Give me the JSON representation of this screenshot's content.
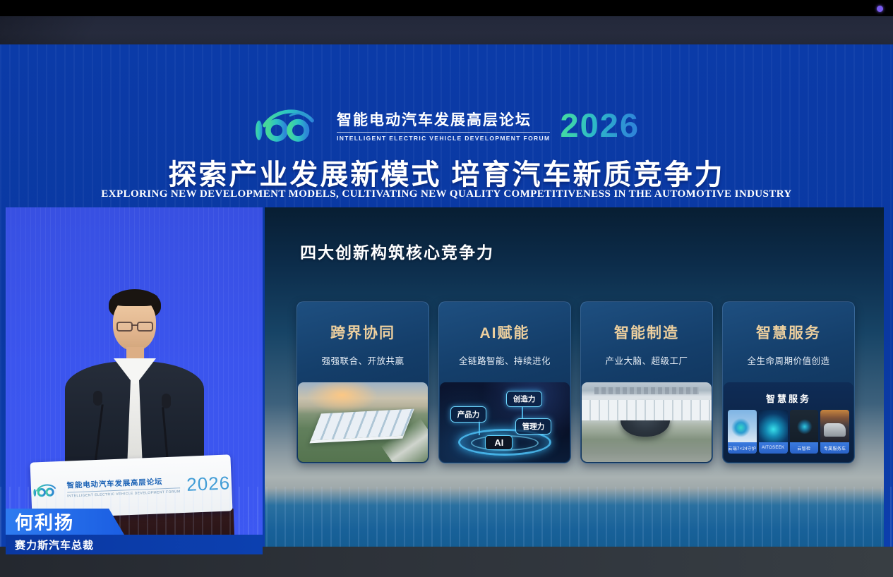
{
  "window": {
    "recording_dot_color": "#7a5cf0"
  },
  "header": {
    "logo": {
      "mark_name": "forum-100-logo",
      "title_cn": "智能电动汽车发展高层论坛",
      "title_en": "INTELLIGENT ELECTRIC VEHICLE DEVELOPMENT FORUM",
      "year": "2026"
    },
    "title_cn": "探索产业发展新模式 培育汽车新质竞争力",
    "title_en": "EXPLORING NEW DEVELOPMENT MODELS, CULTIVATING NEW QUALITY COMPETITIVENESS IN THE AUTOMOTIVE INDUSTRY"
  },
  "speaker_panel": {
    "name": "何利扬",
    "title": "赛力斯汽车总裁",
    "podium_logo": {
      "title_cn": "智能电动汽车发展高层论坛",
      "title_en": "INTELLIGENT ELECTRIC VEHICLE DEVELOPMENT FORUM",
      "year": "2026"
    }
  },
  "slide": {
    "title": "四大创新构筑核心竞争力",
    "cards": [
      {
        "title": "跨界协同",
        "subtitle": "强强联合、开放共赢",
        "image": "factory-aerial-sunrise"
      },
      {
        "title": "AI赋能",
        "subtitle": "全链路智能、持续进化",
        "image": "ai-capability-platform",
        "ai_label": "AI",
        "tags": [
          "产品力",
          "创造力",
          "管理力"
        ]
      },
      {
        "title": "智能制造",
        "subtitle": "产业大脑、超级工厂",
        "image": "smart-factory-round-building"
      },
      {
        "title": "智慧服务",
        "subtitle": "全生命周期价值创造",
        "image": "smart-service-showcase",
        "panel_title": "智慧服务",
        "services": [
          "云端7×24守护",
          "AITOSEEK",
          "云智检",
          "专属服务车"
        ]
      }
    ]
  },
  "colors": {
    "stage_blue": "#0b3aa8",
    "video_backdrop_blue": "#3b55ee",
    "card_title_gold": "#eccf9e",
    "year_teal": "#39cbb4",
    "name_banner_blue": "#1f66e0",
    "service_label_blue": "#2f6fd4"
  }
}
